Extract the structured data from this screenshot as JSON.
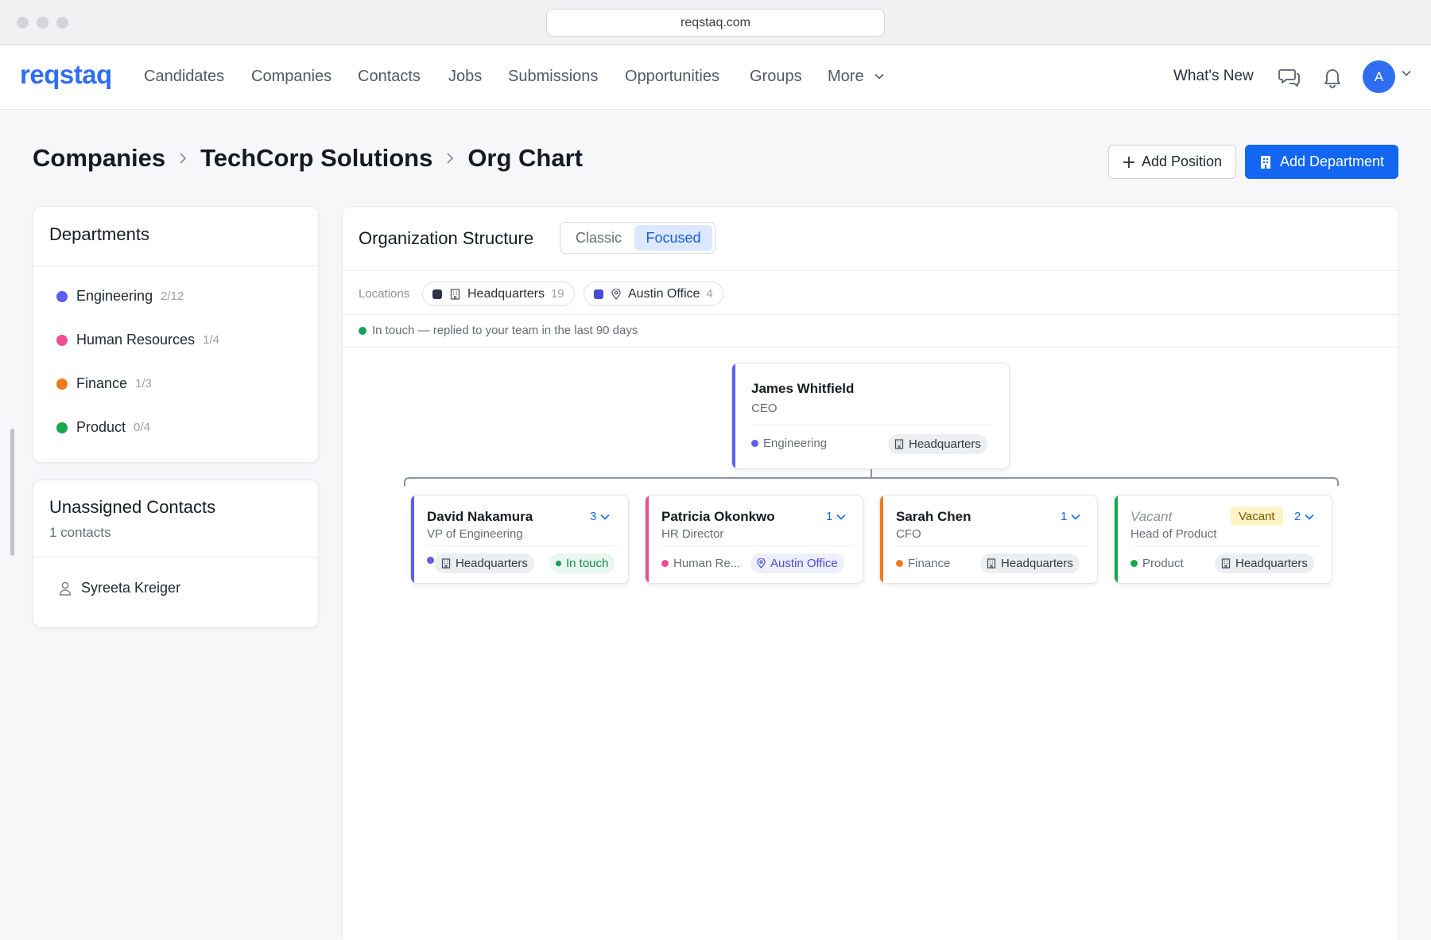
{
  "browser": {
    "url": "reqstaq.com"
  },
  "nav": {
    "logo": "reqstaq",
    "items": [
      "Candidates",
      "Companies",
      "Contacts",
      "Jobs",
      "Submissions",
      "Opportunities",
      "Groups"
    ],
    "more": "More",
    "whats_new": "What's New",
    "avatar_initial": "A"
  },
  "breadcrumb": [
    "Companies",
    "TechCorp Solutions",
    "Org Chart"
  ],
  "actions": {
    "add_position": "Add Position",
    "add_department": "Add Department"
  },
  "departments": {
    "title": "Departments",
    "items": [
      {
        "name": "Engineering",
        "count": "2/12",
        "color": "#5b5ef0"
      },
      {
        "name": "Human Resources",
        "count": "1/4",
        "color": "#ec4f8f"
      },
      {
        "name": "Finance",
        "count": "1/3",
        "color": "#f07a1a"
      },
      {
        "name": "Product",
        "count": "0/4",
        "color": "#1aa64f"
      }
    ]
  },
  "unassigned": {
    "title": "Unassigned Contacts",
    "subtitle": "1 contacts",
    "contacts": [
      "Syreeta Kreiger"
    ]
  },
  "org": {
    "title": "Organization Structure",
    "view_toggle": {
      "options": [
        "Classic",
        "Focused"
      ],
      "selected": "Focused"
    },
    "locations_label": "Locations",
    "locations": [
      {
        "name": "Headquarters",
        "count": "19",
        "color": "#2c3346"
      },
      {
        "name": "Austin Office",
        "count": "4",
        "color": "#4a4ad8"
      }
    ],
    "legend": "In touch — replied to your team in the last 90 days",
    "root": {
      "name": "James Whitfield",
      "title": "CEO",
      "department": "Engineering",
      "location": "Headquarters"
    },
    "reports": [
      {
        "name": "David Nakamura",
        "title": "VP of Engineering",
        "reports": "3",
        "location": "Headquarters",
        "status": "In touch"
      },
      {
        "name": "Patricia Okonkwo",
        "title": "HR Director",
        "reports": "1",
        "department": "Human Re...",
        "location": "Austin Office"
      },
      {
        "name": "Sarah Chen",
        "title": "CFO",
        "reports": "1",
        "department": "Finance",
        "location": "Headquarters"
      },
      {
        "name": "Vacant",
        "badge": "Vacant",
        "title": "Head of Product",
        "reports": "2",
        "department": "Product",
        "location": "Headquarters"
      }
    ]
  }
}
